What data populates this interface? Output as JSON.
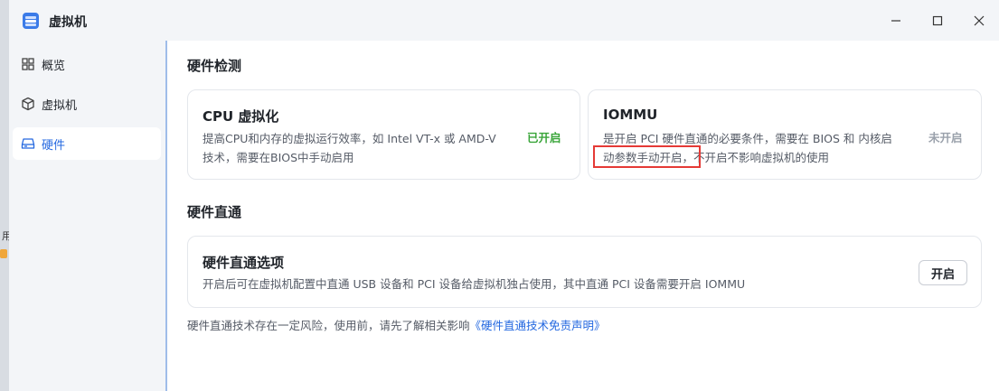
{
  "window": {
    "title": "虚拟机"
  },
  "background_fragment": {
    "text": "用"
  },
  "sidebar": {
    "items": [
      {
        "label": "概览",
        "icon": "grid-icon"
      },
      {
        "label": "虚拟机",
        "icon": "cube-icon"
      },
      {
        "label": "硬件",
        "icon": "drive-icon",
        "active": true
      }
    ]
  },
  "hardware_check": {
    "title": "硬件检测",
    "cpu": {
      "title": "CPU 虚拟化",
      "desc_line1": "提高CPU和内存的虚拟运行效率，如 Intel VT-x 或 AMD-V",
      "desc_line2": "技术，需要在BIOS中手动启用",
      "status": "已开启"
    },
    "iommu": {
      "title": "IOMMU",
      "desc_line1": "是开启 PCI 硬件直通的必要条件，需要在 BIOS 和 内核启",
      "desc_line2_highlight": "动参数手动开启，",
      "desc_line2_rest": "不开启不影响虚拟机的使用",
      "status": "未开启"
    }
  },
  "passthrough": {
    "title": "硬件直通",
    "option": {
      "title": "硬件直通选项",
      "desc": "开启后可在虚拟机配置中直通 USB 设备和 PCI 设备给虚拟机独占使用，其中直通 PCI 设备需要开启 IOMMU",
      "button_label": "开启"
    },
    "footnote": "硬件直通技术存在一定风险，使用前，请先了解相关影响",
    "footnote_link": "《硬件直通技术免责声明》"
  },
  "colors": {
    "accent": "#2468e0",
    "status_on": "#3aa53a",
    "status_off": "#9aa1ab",
    "highlight": "#e53a36"
  }
}
